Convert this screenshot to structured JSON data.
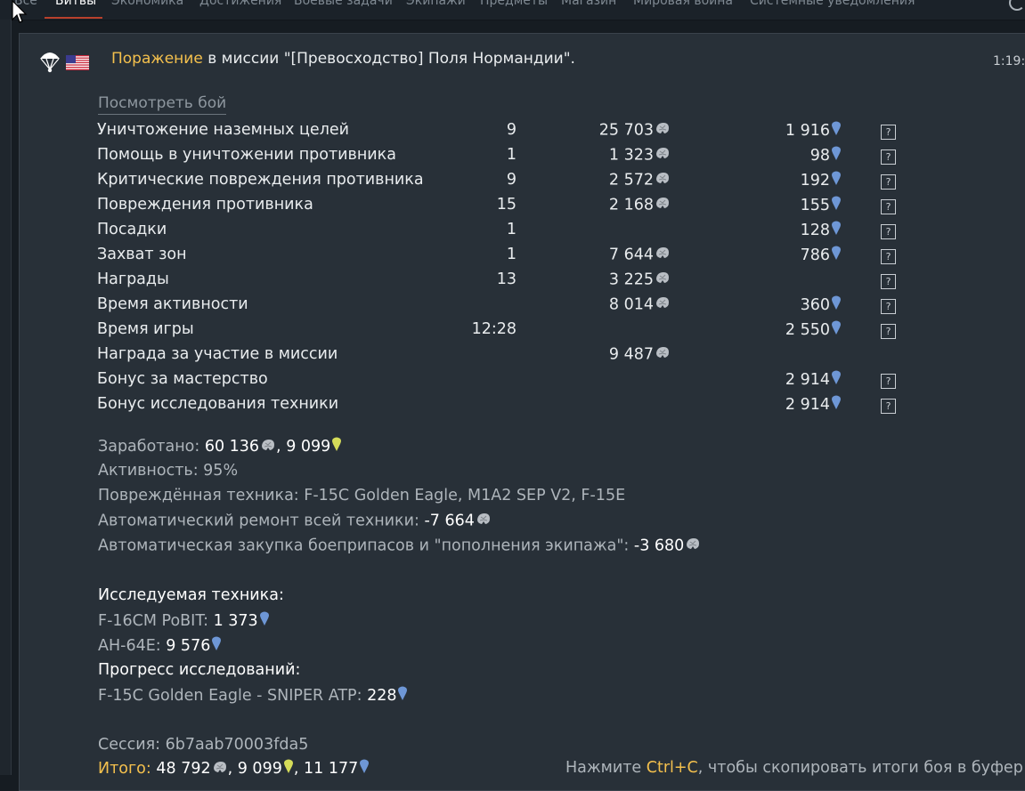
{
  "tabs": [
    "Все",
    "Битвы",
    "Экономика",
    "Достижения",
    "Боевые задачи",
    "Экипажи",
    "Предметы",
    "Магазин",
    "Мировая война",
    "Системные уведомления"
  ],
  "message": {
    "result": "Поражение",
    "mission_text": " в миссии \"[Превосходство] Поля Нормандии\".",
    "time": "1:19:",
    "watch_battle": "Посмотреть бой"
  },
  "rows": [
    {
      "label": "Уничтожение наземных целей",
      "count": "9",
      "silver": "25 703",
      "rp": "1 916",
      "help": true
    },
    {
      "label": "Помощь в уничтожении противника",
      "count": "1",
      "silver": "1 323",
      "rp": "98",
      "help": true
    },
    {
      "label": "Критические повреждения противника",
      "count": "9",
      "silver": "2 572",
      "rp": "192",
      "help": true
    },
    {
      "label": "Повреждения противника",
      "count": "15",
      "silver": "2 168",
      "rp": "155",
      "help": true
    },
    {
      "label": "Посадки",
      "count": "1",
      "silver": "",
      "rp": "128",
      "help": true
    },
    {
      "label": "Захват зон",
      "count": "1",
      "silver": "7 644",
      "rp": "786",
      "help": true
    },
    {
      "label": "Награды",
      "count": "13",
      "silver": "3 225",
      "rp": "",
      "help": true
    },
    {
      "label": "Время активности",
      "count": "",
      "silver": "8 014",
      "rp": "360",
      "help": true
    },
    {
      "label": "Время игры",
      "count": "12:28",
      "silver": "",
      "rp": "2 550",
      "help": true
    },
    {
      "label": "Награда за участие в миссии",
      "count": "",
      "silver": "9 487",
      "rp": "",
      "help": false
    },
    {
      "label": "Бонус за мастерство",
      "count": "",
      "silver": "",
      "rp": "2 914",
      "help": true
    },
    {
      "label": "Бонус исследования техники",
      "count": "",
      "silver": "",
      "rp": "2 914",
      "help": true
    }
  ],
  "help_glyph": "?",
  "summary": {
    "earned_label": "Заработано: ",
    "earned_silver": "60 136",
    "earned_sep": ", ",
    "earned_cp": "9 099",
    "activity_label": "Активность: ",
    "activity_value": "95%",
    "damaged_label": "Повреждённая техника: ",
    "damaged_value": "F-15C Golden Eagle, M1A2 SEP V2, F-15E",
    "repair_label": "Автоматический ремонт всей техники: ",
    "repair_value": "-7 664",
    "ammo_label": "Автоматическая закупка боеприпасов и \"пополнения экипажа\": ",
    "ammo_value": "-3 680",
    "research_heading": "Исследуемая техника:",
    "research_1_label": "F-16CM PoBIT: ",
    "research_1_value": "1 373",
    "research_2_label": "AH-64E: ",
    "research_2_value": "9 576",
    "progress_heading": "Прогресс исследований:",
    "progress_label": "F-15C Golden Eagle - SNIPER ATP: ",
    "progress_value": "228",
    "session_label": "Сессия: ",
    "session_value": "6b7aab70003fda5",
    "total_label": "Итого: ",
    "total_silver": "48 792",
    "total_cp": "9 099",
    "total_rp": "11 177",
    "total_sep": ", "
  },
  "hint": {
    "prefix": "Нажмите ",
    "key": "Ctrl+C",
    "suffix": ", чтобы скопировать итоги боя в буфер обме"
  },
  "colors": {
    "accent_yellow": "#f4c04d",
    "rp_blue": "#6e97d6",
    "cp_yellow": "#d5dc59",
    "silver": "#b9bec4",
    "tab_underline": "#b8402c"
  },
  "icons": [
    "parachute-icon",
    "us-flag-icon",
    "silver-lion-icon",
    "research-point-icon",
    "convertible-point-icon",
    "help-icon",
    "refresh-icon",
    "mouse-cursor-icon"
  ]
}
